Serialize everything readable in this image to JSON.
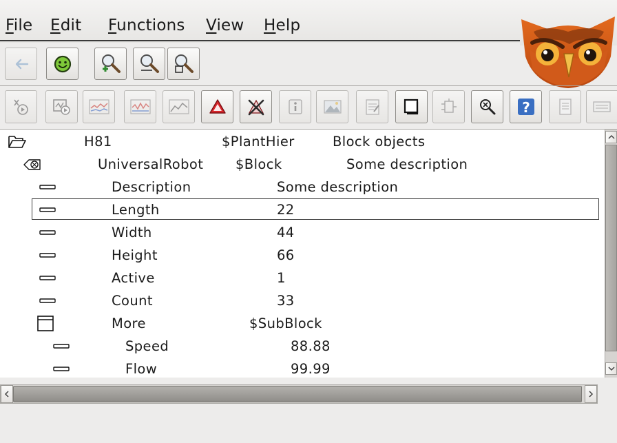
{
  "menubar": {
    "items": [
      {
        "key": "F",
        "rest": "ile"
      },
      {
        "key": "E",
        "rest": "dit"
      },
      {
        "key": "F",
        "rest": "unctions"
      },
      {
        "key": "V",
        "rest": "iew"
      },
      {
        "key": "H",
        "rest": "elp"
      }
    ]
  },
  "logo": "owl-logo",
  "toolbar1": {
    "icons": [
      "back-arrow-icon",
      "smiley-icon",
      "zoom-in-icon",
      "zoom-reset-icon",
      "zoom-out-icon"
    ]
  },
  "toolbar2": {
    "icons": [
      "trace-icon",
      "graph-icon",
      "trend-icon",
      "fast-icon",
      "history-icon",
      "alarm-icon",
      "block-alarm-icon",
      "info-icon",
      "photo-icon",
      "notes-icon",
      "open-object-icon",
      "crossref-icon",
      "search-icon",
      "help-icon",
      "document-icon",
      "class-icon"
    ]
  },
  "tree": {
    "rows": [
      {
        "icon": "folder-open-icon",
        "name": "H81",
        "class": "$PlantHier",
        "value": "Block objects"
      },
      {
        "icon": "object-icon",
        "name": "UniversalRobot",
        "class": "$Block",
        "value": "Some description"
      },
      {
        "icon": "attribute-icon",
        "name": "Description",
        "value": "Some description"
      },
      {
        "icon": "attribute-icon",
        "name": "Length",
        "value": "22",
        "selected": true
      },
      {
        "icon": "attribute-icon",
        "name": "Width",
        "value": "44"
      },
      {
        "icon": "attribute-icon",
        "name": "Height",
        "value": "66"
      },
      {
        "icon": "attribute-icon",
        "name": "Active",
        "value": "1"
      },
      {
        "icon": "attribute-icon",
        "name": "Count",
        "value": "33"
      },
      {
        "icon": "attrobject-icon",
        "name": "More",
        "value": "$SubBlock"
      },
      {
        "icon": "attribute-icon",
        "name": "Speed",
        "value": "88.88"
      },
      {
        "icon": "attribute-icon",
        "name": "Flow",
        "value": "99.99"
      }
    ]
  },
  "colors": {
    "background": "#edeceb",
    "tree_background": "#ffffff",
    "alarm_red": "#d8262b",
    "help_blue": "#3a6fc2",
    "smiley_green": "#7fc93a"
  }
}
